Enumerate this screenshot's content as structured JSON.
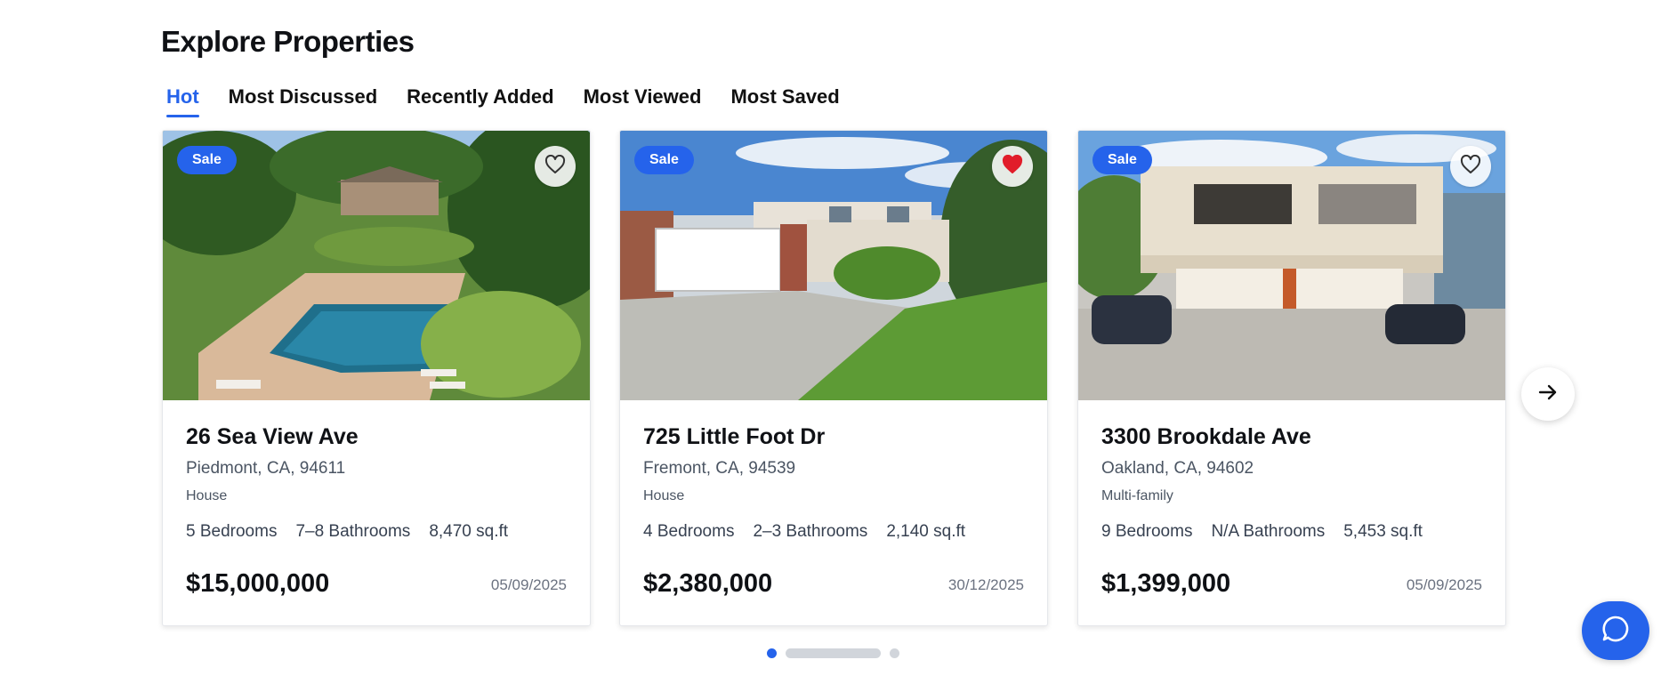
{
  "page": {
    "title": "Explore Properties",
    "accent_color": "#2563eb"
  },
  "tabs": [
    {
      "label": "Hot",
      "active": true
    },
    {
      "label": "Most Discussed",
      "active": false
    },
    {
      "label": "Recently Added",
      "active": false
    },
    {
      "label": "Most Viewed",
      "active": false
    },
    {
      "label": "Most Saved",
      "active": false
    }
  ],
  "listings": [
    {
      "badge": "Sale",
      "favorited": false,
      "address": "26 Sea View Ave",
      "city": "Piedmont, CA, 94611",
      "type": "House",
      "bedrooms": "5 Bedrooms",
      "bathrooms": "7–8 Bathrooms",
      "area": "8,470 sq.ft",
      "price": "$15,000,000",
      "date": "05/09/2025",
      "image": "aerial view of estate with swimming pool and garden"
    },
    {
      "badge": "Sale",
      "favorited": true,
      "address": "725 Little Foot Dr",
      "city": "Fremont, CA, 94539",
      "type": "House",
      "bedrooms": "4 Bedrooms",
      "bathrooms": "2–3 Bathrooms",
      "area": "2,140 sq.ft",
      "price": "$2,380,000",
      "date": "30/12/2025",
      "image": "two-story house with white garage door and lawn"
    },
    {
      "badge": "Sale",
      "favorited": false,
      "address": "3300 Brookdale Ave",
      "city": "Oakland, CA, 94602",
      "type": "Multi-family",
      "bedrooms": "9 Bedrooms",
      "bathrooms": "N/A Bathrooms",
      "area": "5,453 sq.ft",
      "price": "$1,399,000",
      "date": "05/09/2025",
      "image": "multi-family building with garages and parked cars"
    }
  ],
  "carousel": {
    "next_icon": "arrow-right-icon",
    "current_page": 1
  },
  "chat_widget": {
    "icon": "chat-bubble-icon"
  }
}
